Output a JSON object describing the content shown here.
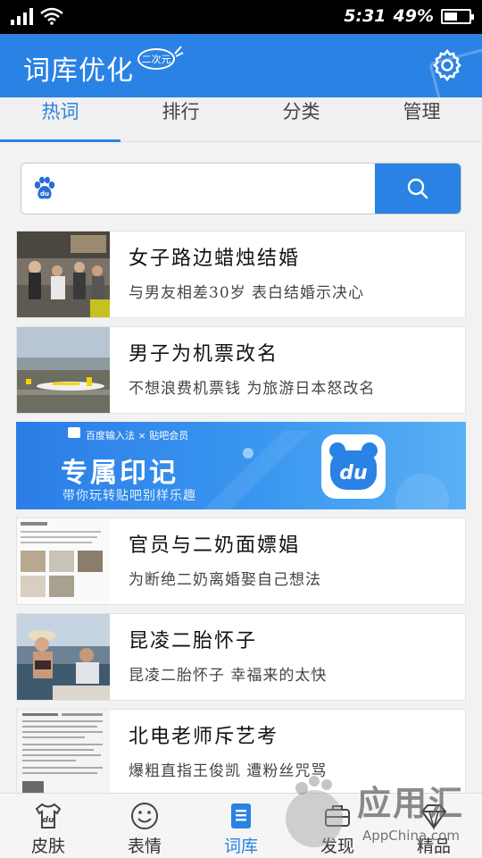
{
  "status": {
    "time": "5:31",
    "battery": "49%"
  },
  "header": {
    "title": "词库优化",
    "badge": "二次元"
  },
  "tabs": [
    {
      "label": "热词"
    },
    {
      "label": "排行"
    },
    {
      "label": "分类"
    },
    {
      "label": "管理"
    }
  ],
  "search": {
    "placeholder": ""
  },
  "news": [
    {
      "title": "女子路边蜡烛结婚",
      "subtitle": "与男友相差30岁  表白结婚示决心"
    },
    {
      "title": "男子为机票改名",
      "subtitle": "不想浪费机票钱 为旅游日本怒改名"
    },
    {
      "title": "官员与二奶面嫖娼",
      "subtitle": "为断绝二奶离婚娶自己想法"
    },
    {
      "title": "昆凌二胎怀子",
      "subtitle": "昆凌二胎怀子 幸福来的太快"
    },
    {
      "title": "北电老师斥艺考",
      "subtitle": "爆粗直指王俊凯 遭粉丝咒骂"
    }
  ],
  "banner": {
    "brand": "百度输入法 × 贴吧会员",
    "heading": "专属印记",
    "subtitle": "带你玩转贴吧别样乐趣"
  },
  "bottom_nav": [
    {
      "label": "皮肤"
    },
    {
      "label": "表情"
    },
    {
      "label": "词库"
    },
    {
      "label": "发现"
    },
    {
      "label": "精品"
    }
  ],
  "watermark": {
    "text": "应用汇",
    "sub": "AppChina.com"
  },
  "colors": {
    "accent": "#2a82e4",
    "background": "#f2f2f2"
  }
}
